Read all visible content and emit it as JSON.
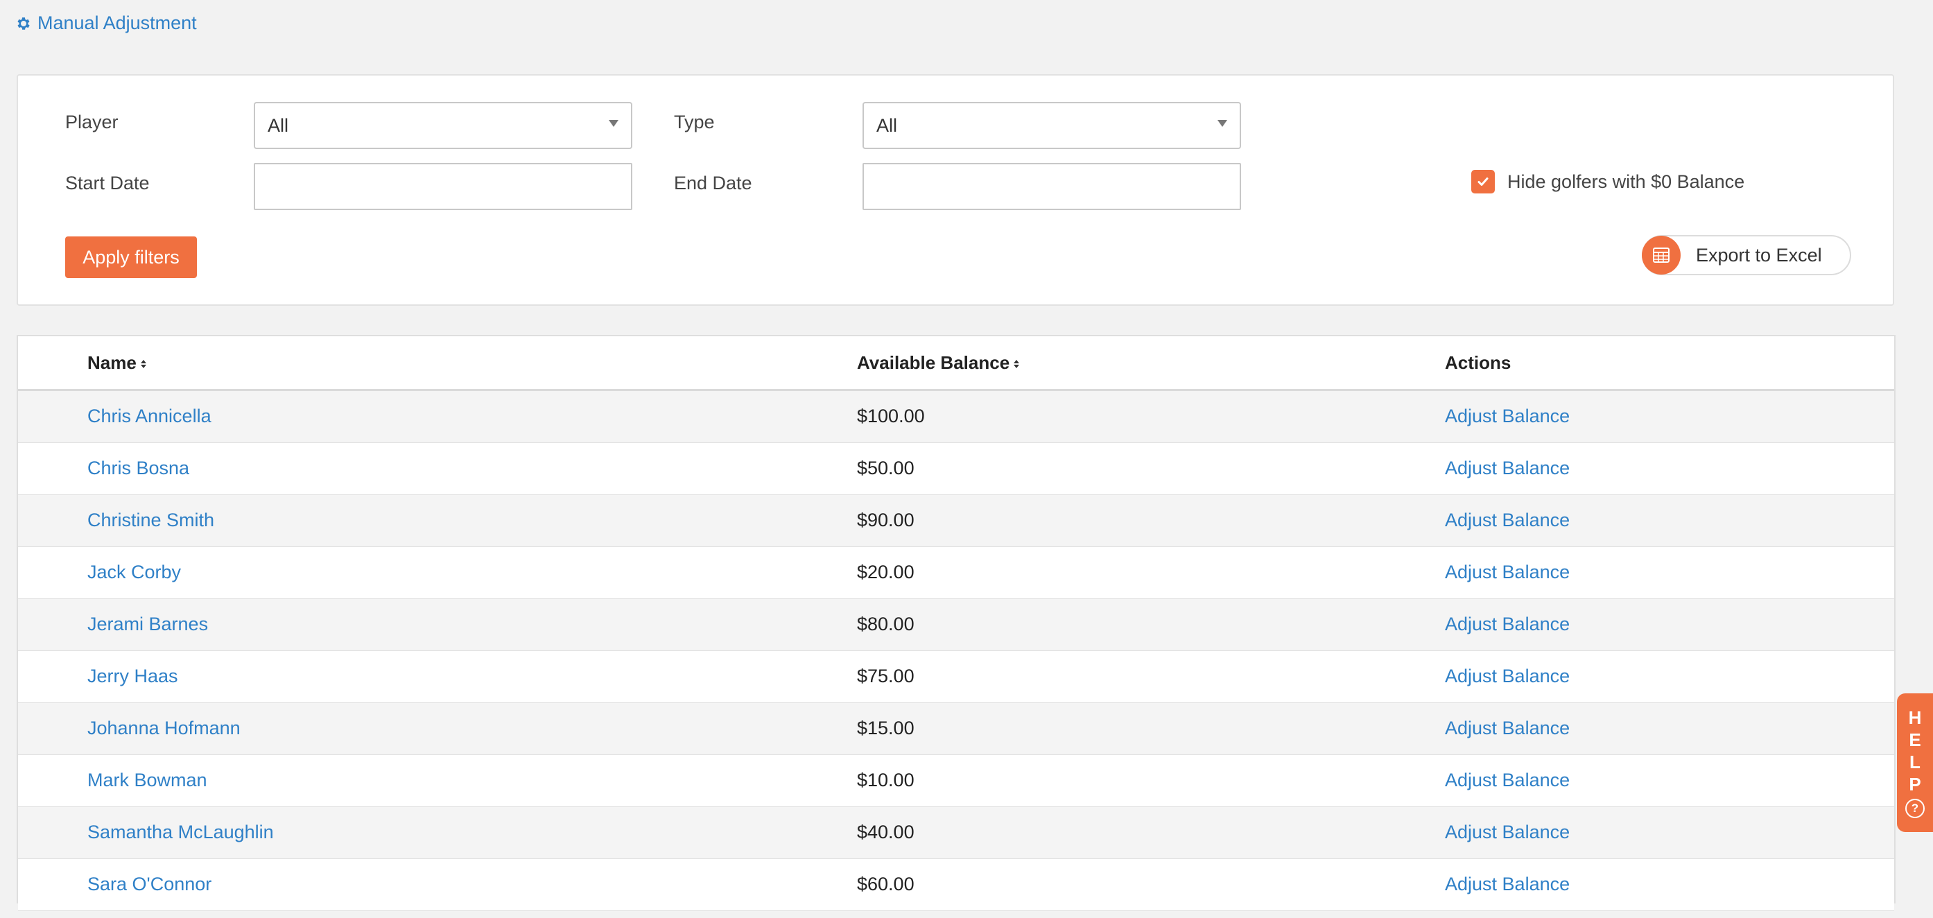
{
  "header": {
    "manual_adjustment_label": "Manual Adjustment"
  },
  "filters": {
    "player_label": "Player",
    "player_value": "All",
    "type_label": "Type",
    "type_value": "All",
    "start_date_label": "Start Date",
    "start_date_value": "",
    "end_date_label": "End Date",
    "end_date_value": "",
    "hide_zero_label": "Hide golfers with $0 Balance",
    "hide_zero_checked": true,
    "apply_label": "Apply filters",
    "export_label": "Export to Excel"
  },
  "table": {
    "columns": {
      "name": "Name",
      "balance": "Available Balance",
      "actions": "Actions"
    },
    "rows": [
      {
        "name": "Chris Annicella",
        "balance": "$100.00",
        "action": "Adjust Balance"
      },
      {
        "name": "Chris Bosna",
        "balance": "$50.00",
        "action": "Adjust Balance"
      },
      {
        "name": "Christine Smith",
        "balance": "$90.00",
        "action": "Adjust Balance"
      },
      {
        "name": "Jack Corby",
        "balance": "$20.00",
        "action": "Adjust Balance"
      },
      {
        "name": "Jerami Barnes",
        "balance": "$80.00",
        "action": "Adjust Balance"
      },
      {
        "name": "Jerry Haas",
        "balance": "$75.00",
        "action": "Adjust Balance"
      },
      {
        "name": "Johanna Hofmann",
        "balance": "$15.00",
        "action": "Adjust Balance"
      },
      {
        "name": "Mark Bowman",
        "balance": "$10.00",
        "action": "Adjust Balance"
      },
      {
        "name": "Samantha McLaughlin",
        "balance": "$40.00",
        "action": "Adjust Balance"
      },
      {
        "name": "Sara O'Connor",
        "balance": "$60.00",
        "action": "Adjust Balance"
      }
    ]
  },
  "help": {
    "letters": [
      "H",
      "E",
      "L",
      "P"
    ],
    "question": "?"
  },
  "colors": {
    "accent": "#f07040",
    "link": "#2f80c7"
  },
  "icons": {
    "manual_adjustment": "gear-icon",
    "checkbox": "check-icon",
    "export": "spreadsheet-icon",
    "sort": "sort-icon",
    "help": "question-circle-icon"
  }
}
